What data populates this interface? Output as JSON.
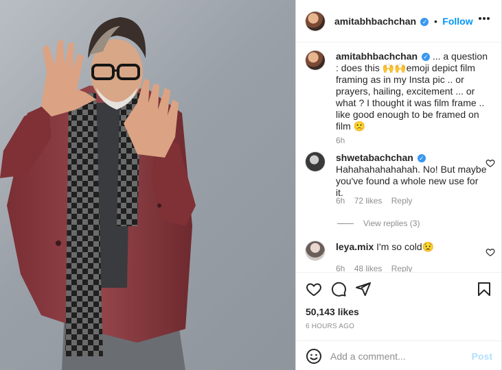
{
  "post": {
    "author": "amitabhbachchan",
    "follow_label": "Follow",
    "more_options_icon": "more-horizontal-icon"
  },
  "caption": {
    "username": "amitabhbachchan",
    "text_part1": "... a question : does this ",
    "emoji1": "🙌",
    "emoji2": "🙌",
    "text_part2": "emoji depict film framing as in my Insta pic .. or prayers, hailing, excitement ... or what ? I thought it was film frame .. like good enough to be framed on film ",
    "emoji3": "🙁",
    "time": "6h"
  },
  "comments": [
    {
      "username": "shwetabachchan",
      "verified": true,
      "text": "Hahahahahahahah. No! But maybe you've found a whole new use for it.",
      "time": "6h",
      "likes": "72 likes",
      "reply_label": "Reply",
      "view_replies": "View replies (3)"
    },
    {
      "username": "leya.mix",
      "verified": false,
      "text": "I'm so cold",
      "emoji": "😟",
      "time": "6h",
      "likes": "48 likes",
      "reply_label": "Reply"
    }
  ],
  "likes_count": "50,143 likes",
  "time_ago": "6 HOURS AGO",
  "add_comment": {
    "placeholder": "Add a comment...",
    "post_label": "Post"
  },
  "icons": {
    "like": "heart-icon",
    "comment": "comment-icon",
    "share": "send-icon",
    "save": "bookmark-icon",
    "emoji": "smile-icon"
  },
  "colors": {
    "link": "#0095f6",
    "verified": "#3897f0",
    "muted": "#8e8e8e",
    "jacket": "#8b3b40"
  }
}
